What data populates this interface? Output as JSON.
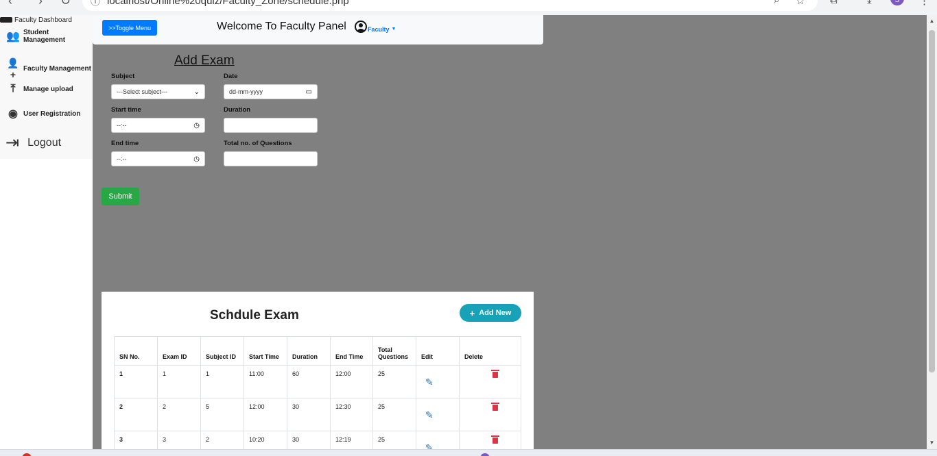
{
  "browser": {
    "url": "localhost/Online%20quiz/Faculty_Zone/schedule.php"
  },
  "sidebar": {
    "brand": "Faculty Dashboard",
    "items": [
      {
        "label": "Student Management",
        "icon": "users-icon"
      },
      {
        "label": "Faculty Management",
        "icon": "user-plus-icon"
      },
      {
        "label": "Manage upload",
        "icon": "upload-icon"
      },
      {
        "label": "User Registration",
        "icon": "user-circle-icon"
      }
    ],
    "logout": "Logout"
  },
  "header": {
    "toggle_label": ">>Toggle Menu",
    "welcome": "Welcome To Faculty Panel",
    "user_label": "Faculty"
  },
  "form": {
    "title": "Add Exam",
    "subject_label": "Subject",
    "subject_value": "---Select subject---",
    "date_label": "Date",
    "date_placeholder": "dd-mm-yyyy",
    "start_label": "Start time",
    "start_value": "--:--",
    "duration_label": "Duration",
    "end_label": "End time",
    "end_value": "--:--",
    "questions_label": "Total no. of Questions",
    "submit_label": "Submit"
  },
  "schedule": {
    "title": "Schdule Exam",
    "add_new_label": "Add New",
    "columns": [
      "SN No.",
      "Exam ID",
      "Subject ID",
      "Start Time",
      "Duration",
      "End Time",
      "Total Questions",
      "Edit",
      "Delete"
    ],
    "rows": [
      {
        "sn": "1",
        "exam_id": "1",
        "subject_id": "1",
        "start": "11:00",
        "duration": "60",
        "end": "12:00",
        "total": "25"
      },
      {
        "sn": "2",
        "exam_id": "2",
        "subject_id": "5",
        "start": "12:00",
        "duration": "30",
        "end": "12:30",
        "total": "25"
      },
      {
        "sn": "3",
        "exam_id": "3",
        "subject_id": "2",
        "start": "10:20",
        "duration": "30",
        "end": "12:19",
        "total": "25"
      }
    ]
  },
  "colors": {
    "primary": "#007bff",
    "success": "#28a745",
    "info": "#17a2b8",
    "danger": "#dc3545",
    "main_bg": "#808080"
  }
}
